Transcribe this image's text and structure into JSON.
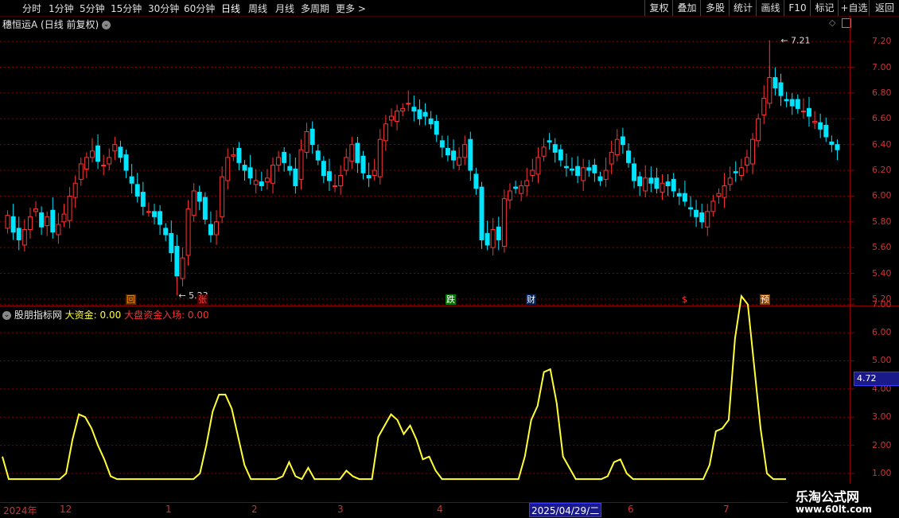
{
  "toolbar": {
    "periods": [
      "分时",
      "1分钟",
      "5分钟",
      "15分钟",
      "30分钟",
      "60分钟",
      "日线",
      "周线",
      "月线",
      "多周期",
      "更多 >"
    ],
    "active_period": "日线",
    "right_buttons": [
      "复权",
      "叠加",
      "多股",
      "统计",
      "画线",
      "F10",
      "标记",
      "+自选",
      "返回"
    ]
  },
  "main_panel": {
    "title": "穗恒运A (日线 前复权)",
    "high_label": "7.21",
    "low_label": "5.23",
    "price_ticks": [
      "7.20",
      "7.00",
      "6.80",
      "6.60",
      "6.40",
      "6.20",
      "6.00",
      "5.80",
      "5.60",
      "5.40",
      "5.20"
    ],
    "markers": [
      {
        "text": "回",
        "color": "#ff8c00",
        "bg": "#5a3000"
      },
      {
        "text": "张",
        "color": "#ff4040",
        "bg": "#4a0000"
      },
      {
        "text": "跌",
        "color": "#ffffff",
        "bg": "#007a00"
      },
      {
        "text": "财",
        "color": "#ffffff",
        "bg": "#00205a"
      },
      {
        "text": "$",
        "color": "#ff3030",
        "bg": "#000000"
      },
      {
        "text": "预",
        "color": "#ffffff",
        "bg": "#8a4000"
      }
    ]
  },
  "indicator_panel": {
    "name": "股朋指标网",
    "label1": "大资金: 0.00",
    "label2": "大盘资金入场: 0.00",
    "ticks": [
      "7.00",
      "6.00",
      "5.00",
      "4.00",
      "3.00",
      "2.00",
      "1.00"
    ],
    "cursor_value": "4.72"
  },
  "date_axis": {
    "labels": [
      "2024年",
      "12",
      "1",
      "2",
      "3",
      "4",
      "6",
      "7"
    ],
    "cursor_date": "2025/04/29/二"
  },
  "watermark": {
    "line1": "乐淘公式网",
    "line2": "www.60lt.com"
  },
  "colors": {
    "up": "#ff3333",
    "down": "#00e5ff",
    "indicator": "#ffff33",
    "grid": "#8a0000"
  },
  "chart_data": [
    {
      "type": "candlestick",
      "title": "穗恒运A (日线 前复权)",
      "ylim": [
        5.15,
        7.3
      ],
      "close": [
        5.85,
        5.72,
        5.66,
        5.74,
        5.84,
        5.9,
        5.76,
        5.84,
        5.72,
        5.78,
        5.86,
        6.0,
        6.1,
        6.25,
        6.3,
        6.35,
        6.27,
        6.24,
        6.3,
        6.4,
        6.3,
        6.2,
        6.1,
        6.0,
        5.92,
        5.88,
        5.84,
        5.78,
        5.7,
        5.56,
        5.38,
        5.52,
        5.9,
        6.04,
        5.96,
        5.82,
        5.7,
        5.8,
        6.15,
        6.3,
        6.32,
        6.26,
        6.2,
        6.14,
        6.12,
        6.08,
        6.14,
        6.24,
        6.3,
        6.26,
        6.2,
        6.08,
        6.36,
        6.5,
        6.4,
        6.28,
        6.16,
        6.12,
        6.08,
        6.16,
        6.3,
        6.4,
        6.26,
        6.18,
        6.14,
        6.2,
        6.44,
        6.56,
        6.62,
        6.66,
        6.68,
        6.72,
        6.66,
        6.6,
        6.62,
        6.56,
        6.48,
        6.38,
        6.32,
        6.28,
        6.3,
        6.4,
        6.2,
        6.06,
        5.66,
        5.62,
        5.74,
        5.66,
        5.98,
        6.04,
        6.06,
        6.08,
        6.12,
        6.2,
        6.3,
        6.38,
        6.42,
        6.34,
        6.28,
        6.22,
        6.2,
        6.16,
        6.22,
        6.2,
        6.18,
        6.12,
        6.2,
        6.34,
        6.44,
        6.4,
        6.26,
        6.12,
        6.08,
        6.14,
        6.1,
        6.06,
        6.1,
        6.08,
        6.04,
        6.0,
        5.96,
        5.9,
        5.84,
        5.8,
        5.88,
        5.96,
        6.02,
        6.08,
        6.14,
        6.18,
        6.22,
        6.3,
        6.44,
        6.6,
        6.76,
        6.92,
        6.84,
        6.78,
        6.74,
        6.7,
        6.68,
        6.66,
        6.62,
        6.58,
        6.52,
        6.46,
        6.4,
        6.36
      ]
    },
    {
      "type": "line",
      "title": "股朋指标网",
      "ylim": [
        1.0,
        7.5
      ],
      "series": [
        {
          "name": "大资金",
          "values": [
            1.6,
            0.8,
            0.8,
            0.8,
            0.8,
            0.8,
            0.8,
            0.8,
            0.8,
            0.8,
            1.0,
            2.2,
            3.1,
            3.0,
            2.6,
            2.0,
            1.5,
            0.9,
            0.8,
            0.8,
            0.8,
            0.8,
            0.8,
            0.8,
            0.8,
            0.8,
            0.8,
            0.8,
            0.8,
            0.8,
            0.8,
            1.0,
            2.0,
            3.2,
            3.8,
            3.8,
            3.3,
            2.3,
            1.3,
            0.8,
            0.8,
            0.8,
            0.8,
            0.8,
            0.9,
            1.4,
            0.9,
            0.8,
            1.2,
            0.8,
            0.8,
            0.8,
            0.8,
            0.8,
            1.1,
            0.9,
            0.8,
            0.8,
            0.8,
            2.3,
            2.7,
            3.1,
            2.9,
            2.4,
            2.7,
            2.2,
            1.5,
            1.6,
            1.1,
            0.8,
            0.8,
            0.8,
            0.8,
            0.8,
            0.8,
            0.8,
            0.8,
            0.8,
            0.8,
            0.8,
            0.8,
            0.8,
            1.6,
            2.9,
            3.4,
            4.6,
            4.7,
            3.5,
            1.6,
            1.2,
            0.8,
            0.8,
            0.8,
            0.8,
            0.8,
            0.9,
            1.4,
            1.5,
            1.0,
            0.8,
            0.8,
            0.8,
            0.8,
            0.8,
            0.8,
            0.8,
            0.8,
            0.8,
            0.8,
            0.8,
            0.8,
            1.3,
            2.5,
            2.6,
            2.9,
            5.8,
            7.3,
            7.0,
            4.8,
            2.6,
            1.0,
            0.8,
            0.8,
            0.8
          ]
        }
      ]
    }
  ]
}
